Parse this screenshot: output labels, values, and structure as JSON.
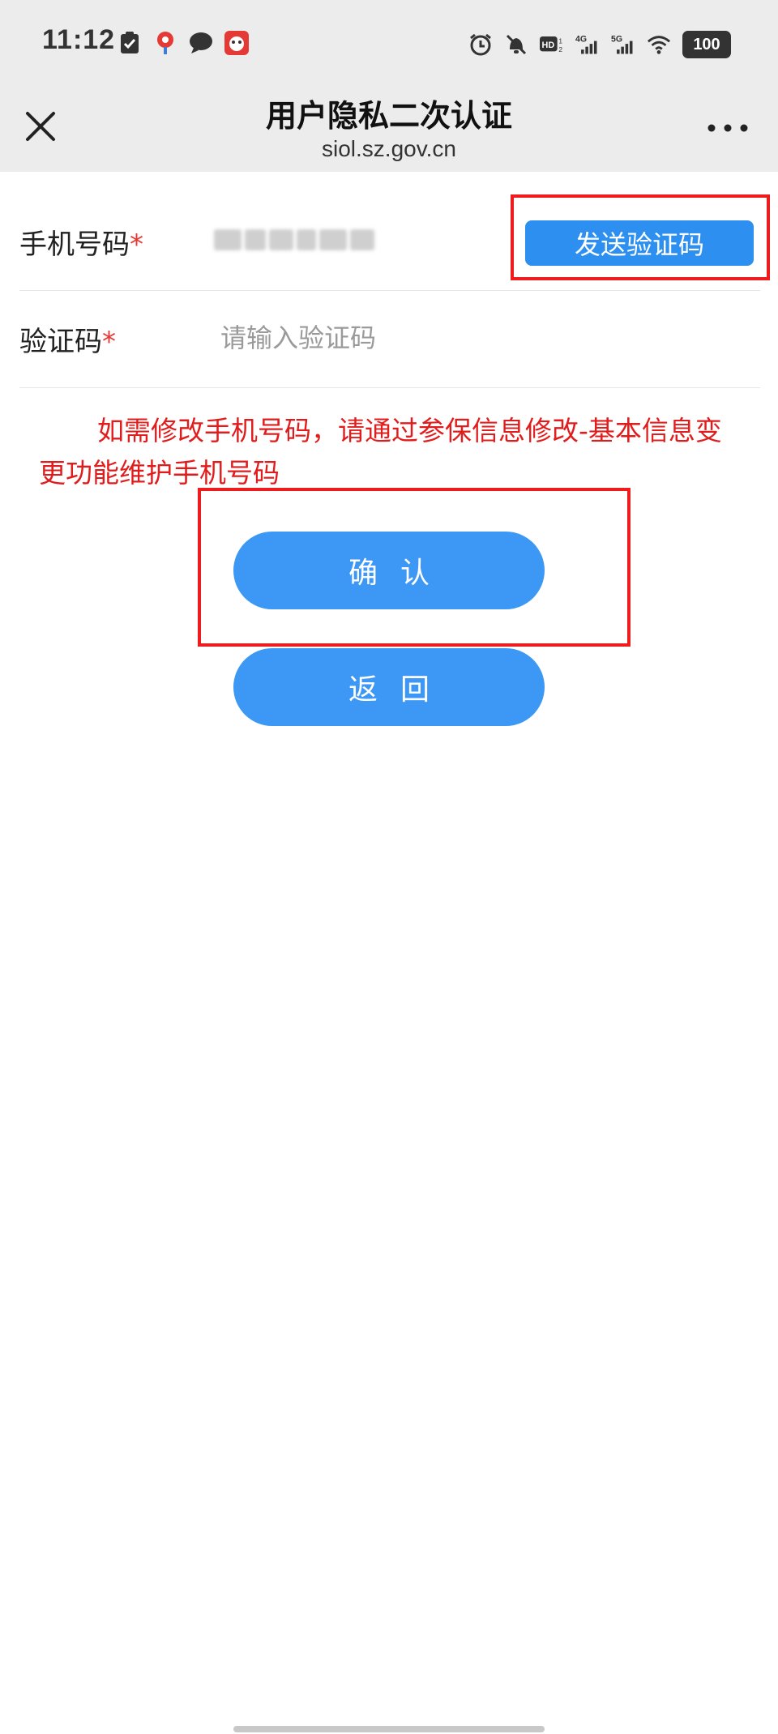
{
  "status_bar": {
    "time": "11:12",
    "battery": "100",
    "icons_left": [
      "clipboard-check-icon",
      "location-pin-icon",
      "chat-bubble-icon",
      "red-app-icon"
    ],
    "icons_right": [
      "alarm-icon",
      "bell-muted-icon",
      "hd-icon",
      "signal-4g-icon",
      "signal-5g-icon",
      "wifi-icon",
      "battery-icon"
    ]
  },
  "header": {
    "title": "用户隐私二次认证",
    "url": "siol.sz.gov.cn"
  },
  "form": {
    "phone_label": "手机号码",
    "required_mark": "*",
    "send_code_label": "发送验证码",
    "code_label": "验证码",
    "code_placeholder": "请输入验证码",
    "code_value": ""
  },
  "notice": "如需修改手机号码，请通过参保信息修改-基本信息变更功能维护手机号码",
  "buttons": {
    "confirm": "确认",
    "back": "返回"
  },
  "colors": {
    "primary": "#3d98f5",
    "send_button": "#2d8ff0",
    "notice_text": "#e11c1c",
    "annotation": "#ee1c1c",
    "header_bg": "#ececec"
  }
}
